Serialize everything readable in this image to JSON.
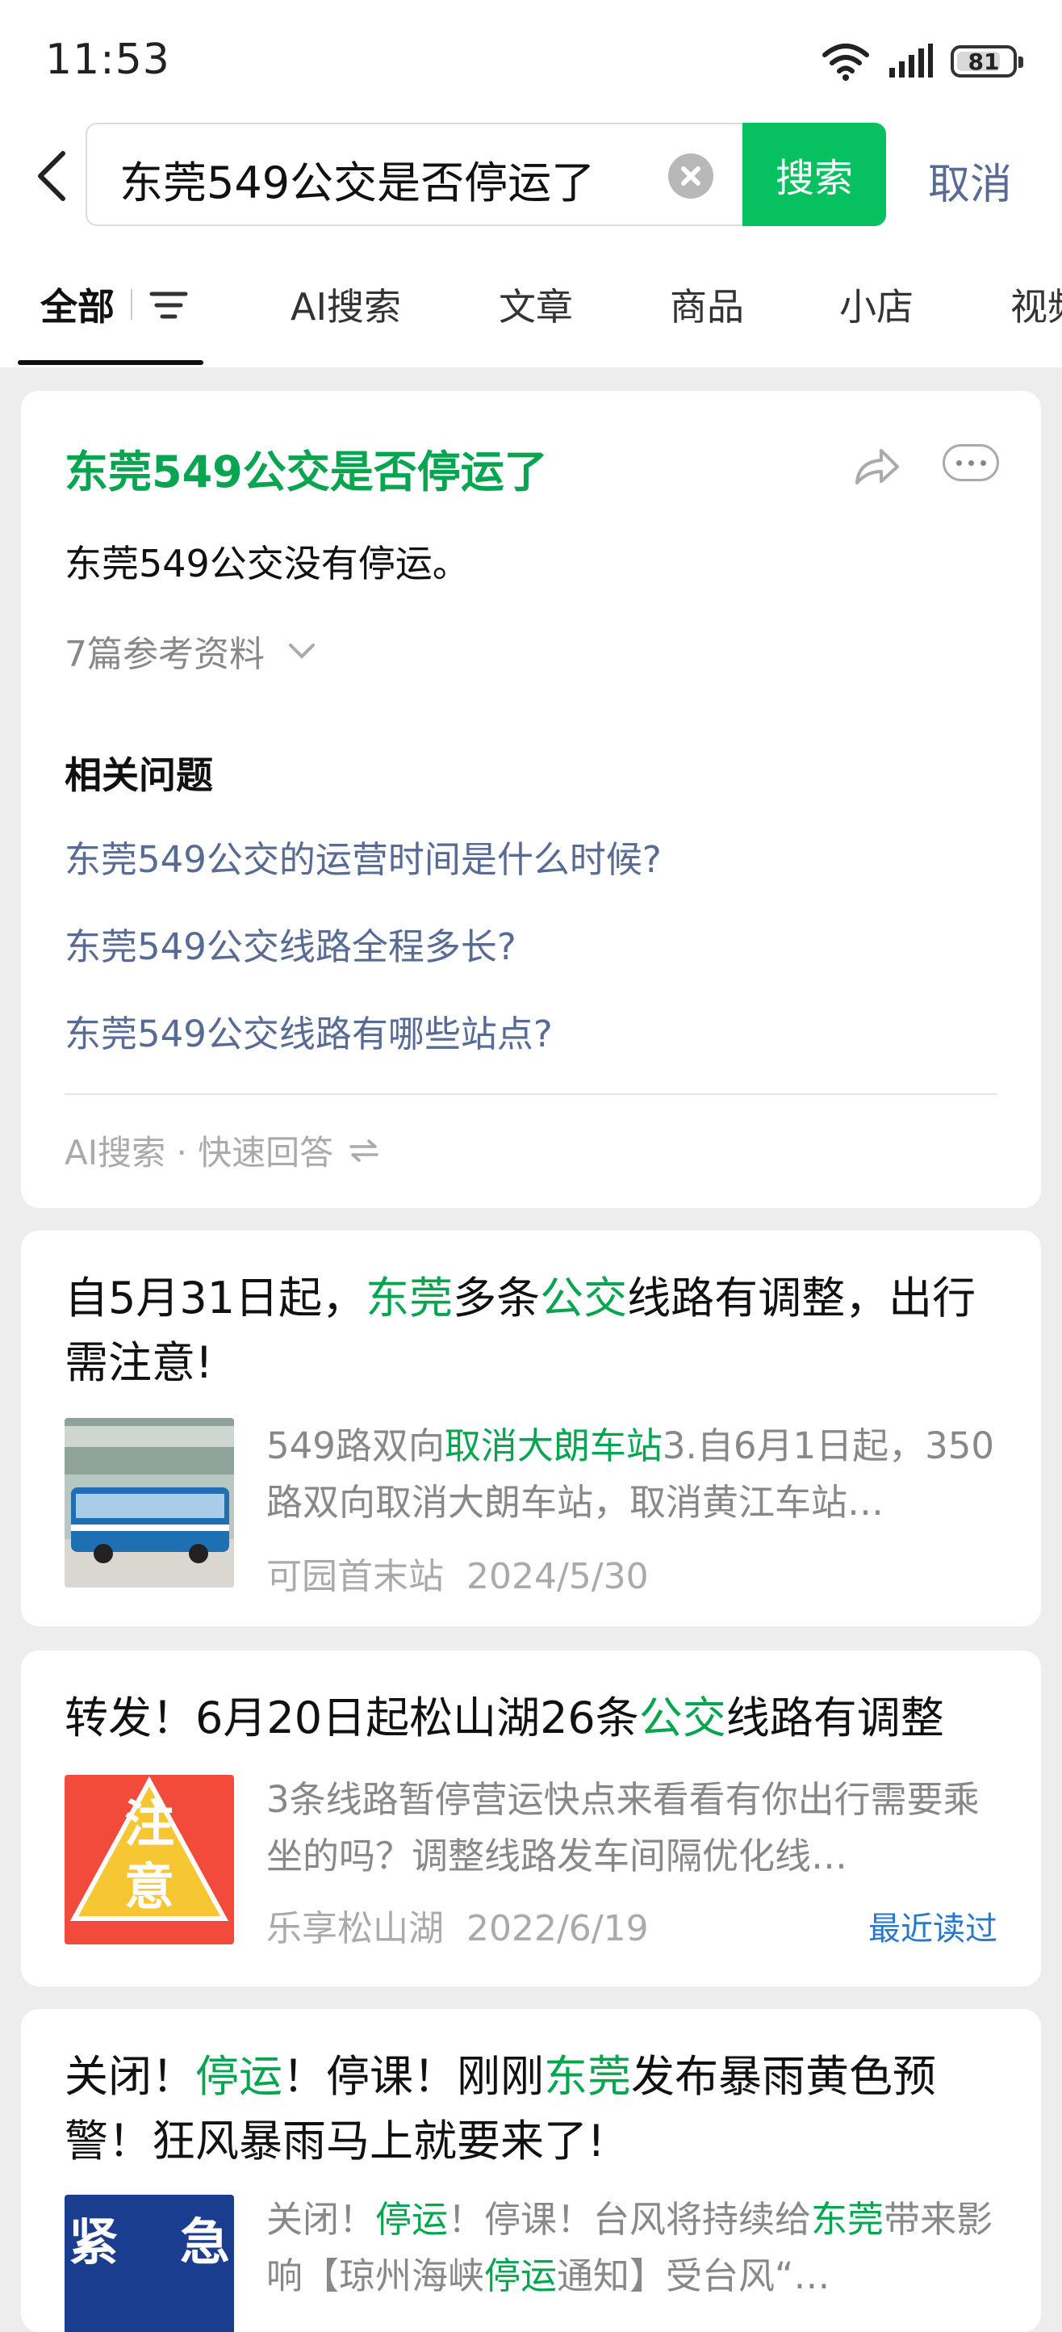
{
  "status_bar": {
    "time": "11:53",
    "battery": "81",
    "battery_level_percent": 81
  },
  "search": {
    "query": "东莞549公交是否停运了",
    "search_button": "搜索",
    "cancel": "取消"
  },
  "tabs": [
    "全部",
    "AI搜索",
    "文章",
    "商品",
    "小店",
    "视频"
  ],
  "ai_card": {
    "title": "东莞549公交是否停运了",
    "answer": "东莞549公交没有停运。",
    "refs": "7篇参考资料",
    "related_heading": "相关问题",
    "related": [
      "东莞549公交的运营时间是什么时候?",
      "东莞549公交线路全程多长?",
      "东莞549公交线路有哪些站点?"
    ],
    "footer": "AI搜索 · 快速回答"
  },
  "articles": [
    {
      "title_parts": [
        "自5月31日起，",
        "东莞",
        "多条",
        "公交",
        "线路有调整，出行需注意!"
      ],
      "snippet_parts": [
        "549路双向",
        "取消大朗车站",
        "3.自6月1日起，350路双向取消大朗车站，取消黄江车站…"
      ],
      "source": "可园首末站",
      "date": "2024/5/30"
    },
    {
      "title_parts": [
        "转发！6月20日起松山湖26条",
        "公交",
        "线路有调整"
      ],
      "snippet_parts": [
        "3条线路暂停营运快点来看看有你出行需要乘坐的吗？调整线路发车间隔优化线…"
      ],
      "thumb_text": [
        "注",
        "意"
      ],
      "source": "乐享松山湖",
      "date": "2022/6/19",
      "badge": "最近读过"
    },
    {
      "title_parts": [
        "关闭！",
        "停运",
        "！停课！刚刚",
        "东莞",
        "发布暴雨黄色预警！狂风暴雨马上就要来了!"
      ],
      "snippet_parts": [
        "关闭！",
        "停运",
        "！停课！台风将持续给",
        "东莞",
        "带来影响【琼州海峡",
        "停运",
        "通知】受台风“…"
      ],
      "thumb_text": [
        "紧",
        "急"
      ]
    }
  ],
  "colors": {
    "accent": "#07c160",
    "highlight": "#07a550",
    "link": "#576b95",
    "recent": "#2a79c8"
  }
}
